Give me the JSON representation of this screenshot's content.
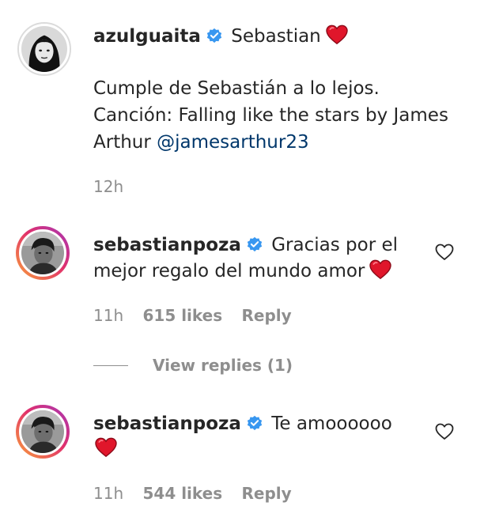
{
  "post": {
    "username": "azulguaita",
    "title": "Sebastian",
    "caption_line1": "Cumple de Sebastián a lo lejos.",
    "caption_line2": "Canción: Falling like the stars by James",
    "caption_line3": "Arthur",
    "mention": "@jamesarthur23",
    "time": "12h"
  },
  "comments": [
    {
      "username": "sebastianpoza",
      "text_line1": "Gracias por el",
      "text_line2": "mejor regalo del mundo amor",
      "time": "11h",
      "likes": "615 likes",
      "reply": "Reply"
    },
    {
      "username": "sebastianpoza",
      "text_line1": "Te amoooooo",
      "time": "11h",
      "likes": "544 likes",
      "reply": "Reply"
    }
  ],
  "view_replies": "View replies (1)",
  "icons": {
    "verified": "verified-badge-icon",
    "heart": "red-heart-emoji",
    "like": "heart-outline-icon"
  },
  "colors": {
    "verified": "#3897f0",
    "heart": "#e0162b",
    "mention": "#00376b",
    "secondary_text": "#8e8e8e"
  }
}
